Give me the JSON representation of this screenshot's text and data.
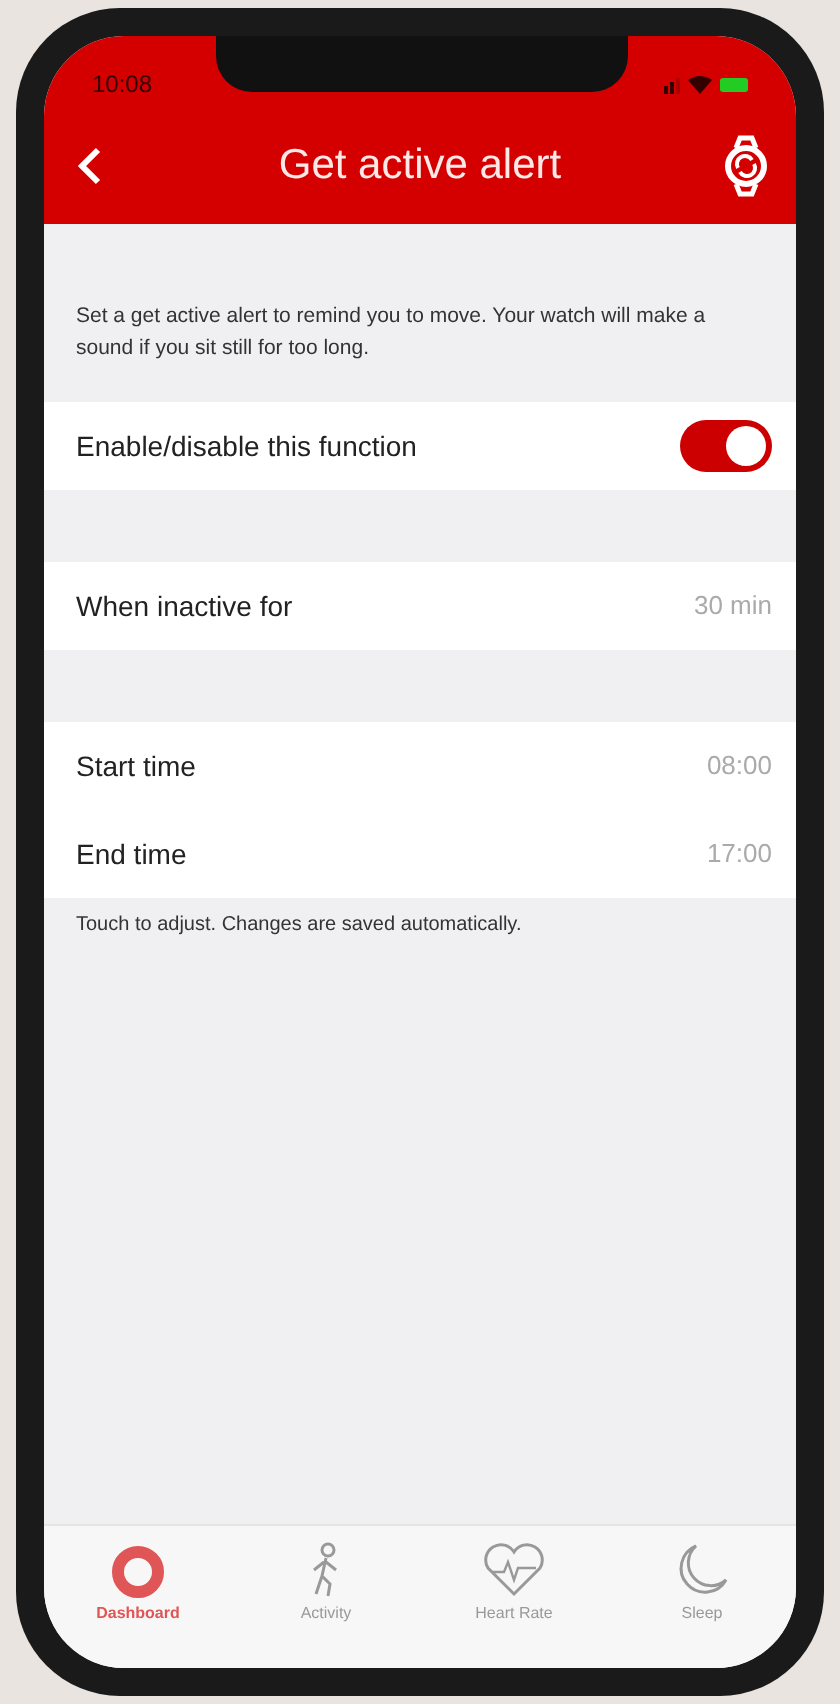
{
  "status_bar": {
    "time": "10:08"
  },
  "header": {
    "title": "Get active alert"
  },
  "intro": "Set a get active alert to remind you to move. Your watch will make a sound if you sit still for too long.",
  "sections": [
    {
      "rows": [
        {
          "kind": "toggle",
          "label": "Enable/disable this function",
          "on": true
        }
      ]
    },
    {
      "rows": [
        {
          "kind": "value",
          "label": "When inactive for",
          "value": "30 min"
        }
      ]
    },
    {
      "rows": [
        {
          "kind": "value",
          "label": "Start time",
          "value": "08:00"
        },
        {
          "kind": "value",
          "label": "End time",
          "value": "17:00"
        }
      ]
    }
  ],
  "footnote": "Touch to adjust. Changes are saved automatically.",
  "tab_bar": [
    {
      "kind": "dashboard",
      "label": "Dashboard",
      "selected": true
    },
    {
      "kind": "activity",
      "label": "Activity",
      "selected": false
    },
    {
      "kind": "heart",
      "label": "Heart Rate",
      "selected": false
    },
    {
      "kind": "sleep",
      "label": "Sleep",
      "selected": false
    }
  ]
}
